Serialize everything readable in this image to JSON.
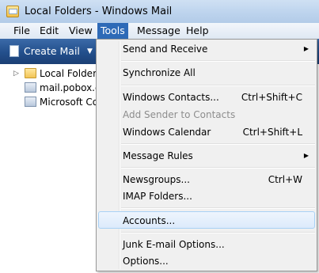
{
  "window": {
    "title": "Local Folders - Windows Mail"
  },
  "menubar": {
    "items": [
      "File",
      "Edit",
      "View",
      "Tools",
      "Message",
      "Help"
    ],
    "active": "Tools"
  },
  "toolbar": {
    "create_mail": "Create Mail"
  },
  "folders": [
    {
      "label": "Local Folders",
      "icon": "folder-icon",
      "expander": "▷"
    },
    {
      "label": "mail.pobox.co",
      "icon": "server-icon"
    },
    {
      "label": "Microsoft Co",
      "icon": "server-icon"
    }
  ],
  "tools_menu": {
    "items": [
      {
        "label": "Send and Receive",
        "submenu": true
      },
      {
        "label": "Synchronize All"
      },
      {
        "label": "Windows Contacts...",
        "shortcut": "Ctrl+Shift+C"
      },
      {
        "label": "Add Sender to Contacts",
        "disabled": true
      },
      {
        "label": "Windows Calendar",
        "shortcut": "Ctrl+Shift+L"
      },
      {
        "label": "Message Rules",
        "submenu": true
      },
      {
        "label": "Newsgroups...",
        "shortcut": "Ctrl+W"
      },
      {
        "label": "IMAP Folders..."
      },
      {
        "label": "Accounts...",
        "highlighted": true
      },
      {
        "label": "Junk E-mail Options..."
      },
      {
        "label": "Options..."
      }
    ],
    "submenu_arrow": "▶"
  }
}
